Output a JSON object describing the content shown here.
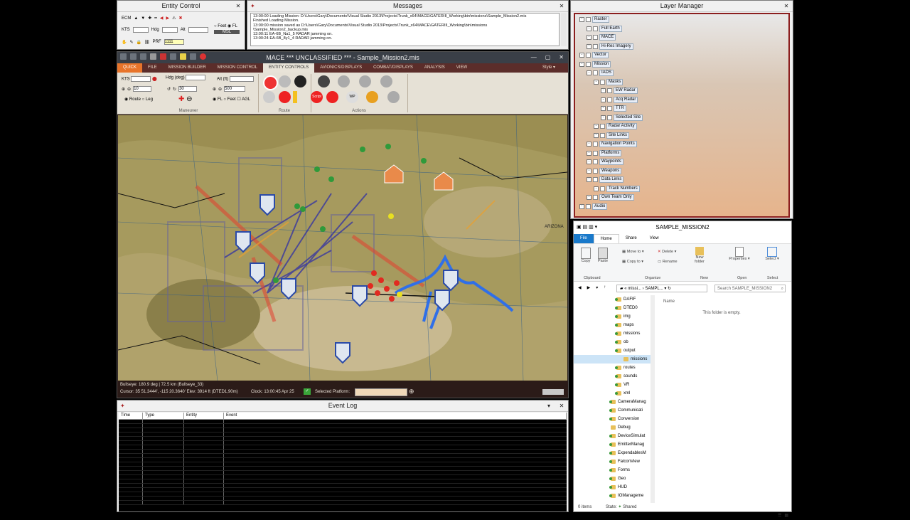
{
  "entity_control": {
    "title": "Entity Control",
    "kts_label": "KTS",
    "hdg_label": "Hdg",
    "alt_label": "Alt",
    "feet_label": "Feet",
    "fl_label": "FL",
    "msl_label": "MSL",
    "prf_label": "PRF",
    "prf_value": "1111",
    "ecm_label": "ECM"
  },
  "messages": {
    "title": "Messages",
    "lines": [
      "13:00:00 Loading Mission: D:\\Users\\Gary\\Documents\\Visual Studio 2013\\Projects\\Trunk_x64\\MACE\\GATERIII_Working\\bin\\missions\\Sample_Mission2.mis",
      "Finished Loading Mission.",
      "13:00:00 mission saved as D:\\Users\\Gary\\Documents\\Visual Studio 2013\\Projects\\Trunk_x64\\MACE\\GATERIII_Working\\bin\\missions",
      "\\Sample_Mission2_backup.mis",
      "13:00:11 EA-6B_Na1_5 RADAR jamming on.",
      "13:00:24 EA-6B_8y1_4 RADAR jamming on."
    ]
  },
  "mace": {
    "title": "MACE  *** UNCLASSIFIED ***  - Sample_Mission2.mis",
    "tabs": [
      "QUICK",
      "FILE",
      "MISSION BUILDER",
      "MISSION CONTROL",
      "ENTITY CONTROLS",
      "AVIONICS/DISPLAYS",
      "COMBAT/DISPLAYS",
      "ANALYSIS",
      "VIEW"
    ],
    "style_label": "Style",
    "maneuver": {
      "kts_label": "KTS",
      "hdg_label": "Hdg (deg)",
      "alt_label": "Alt (ft)",
      "step1": "10",
      "step2": "30",
      "step3": "500",
      "route_label": "Route",
      "leg_label": "Leg",
      "fl_label": "FL",
      "feet_label": "Feet",
      "agl_label": "AGL",
      "group_label": "Maneuver"
    },
    "route_group_label": "Route",
    "actions_group_label": "Actions",
    "script_label": "Script",
    "wp_label": "WP",
    "status": {
      "bullseye": "Bullseye: 180.9 deg | 72.5 km  (Bullseye_33)",
      "cursor": "Cursor: 35 51.3444', -115 20.3640'  Elev: 3914 ft (DTED1,90m)",
      "clock": "Clock: 13:00:45  Apr 25",
      "selected_platform": "Selected Platform:"
    },
    "map_labels": [
      "ARIZONA"
    ]
  },
  "event_log": {
    "title": "Event Log",
    "columns": [
      "Time",
      "Type",
      "Entity",
      "Event"
    ]
  },
  "layer_manager": {
    "title": "Layer Manager",
    "nodes": [
      {
        "label": "Raster",
        "depth": 0
      },
      {
        "label": "Full Earth",
        "depth": 1
      },
      {
        "label": "MACE",
        "depth": 1
      },
      {
        "label": "Hi-Res Imagery",
        "depth": 1
      },
      {
        "label": "Vector",
        "depth": 0
      },
      {
        "label": "Mission",
        "depth": 0
      },
      {
        "label": "IADS",
        "depth": 1
      },
      {
        "label": "Masks",
        "depth": 2
      },
      {
        "label": "EW Radar",
        "depth": 3
      },
      {
        "label": "Acq Radar",
        "depth": 3
      },
      {
        "label": "TTR",
        "depth": 3
      },
      {
        "label": "Selected Site",
        "depth": 3
      },
      {
        "label": "Radar Activity",
        "depth": 2
      },
      {
        "label": "Site Links",
        "depth": 2
      },
      {
        "label": "Navigation Points",
        "depth": 1
      },
      {
        "label": "Platforms",
        "depth": 1
      },
      {
        "label": "Waypoints",
        "depth": 1
      },
      {
        "label": "Weapons",
        "depth": 1
      },
      {
        "label": "Data Links",
        "depth": 1
      },
      {
        "label": "Track Numbers",
        "depth": 2
      },
      {
        "label": "Own Team Only",
        "depth": 1
      },
      {
        "label": "Audio",
        "depth": 0
      }
    ]
  },
  "explorer": {
    "title": "SAMPLE_MISSION2",
    "tabs": [
      "File",
      "Home",
      "Share",
      "View"
    ],
    "groups": [
      "Clipboard",
      "Organize",
      "New",
      "Open",
      "Select"
    ],
    "buttons": [
      "Copy",
      "Paste",
      "Move to",
      "Copy to",
      "Delete",
      "Rename",
      "New folder",
      "Properties",
      "Select"
    ],
    "breadcrumb": [
      "missi...",
      "SAMPL..."
    ],
    "search_placeholder": "Search SAMPLE_MISSION2",
    "column_name": "Name",
    "empty_text": "This folder is empty.",
    "tree": [
      {
        "label": "DAFIF",
        "g": true
      },
      {
        "label": "DTED0",
        "g": true
      },
      {
        "label": "img",
        "g": true
      },
      {
        "label": "maps",
        "g": true
      },
      {
        "label": "missions",
        "g": true
      },
      {
        "label": "ob",
        "g": true
      },
      {
        "label": "output",
        "g": true
      },
      {
        "label": "missions",
        "g": false
      },
      {
        "label": "routes",
        "g": true
      },
      {
        "label": "sounds",
        "g": true
      },
      {
        "label": "VR",
        "g": true
      },
      {
        "label": "xml",
        "g": true
      },
      {
        "label": "CameraManag",
        "g": true
      },
      {
        "label": "Communicati",
        "g": true
      },
      {
        "label": "Conversion",
        "g": true
      },
      {
        "label": "Debug",
        "g": false
      },
      {
        "label": "DeviceSimulat",
        "g": true
      },
      {
        "label": "EmitterManag",
        "g": true
      },
      {
        "label": "ExpendablesM",
        "g": true
      },
      {
        "label": "FalconView",
        "g": true
      },
      {
        "label": "Forms",
        "g": true
      },
      {
        "label": "Geo",
        "g": true
      },
      {
        "label": "HUD",
        "g": true
      },
      {
        "label": "IOManageme",
        "g": true
      }
    ],
    "status_items": "0 items",
    "status_state": "State:",
    "status_shared": "Shared"
  }
}
